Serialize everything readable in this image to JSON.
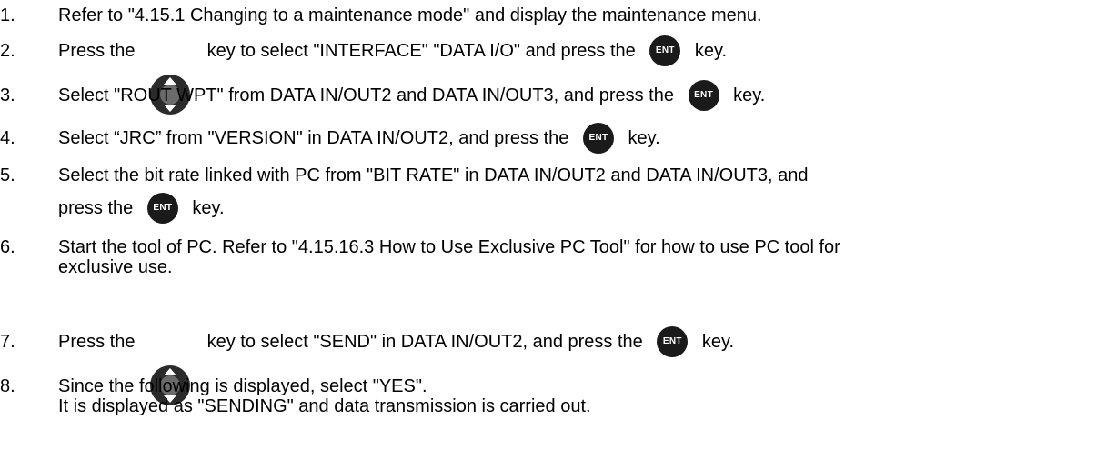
{
  "keys": {
    "ent_label": "ENT",
    "ent_icon": "ent-key-icon",
    "cross_icon": "cursor-key-icon"
  },
  "steps": [
    {
      "num": "1.",
      "text": "Refer to \"4.15.1 Changing to a maintenance mode\" and display the maintenance menu."
    },
    {
      "num": "2.",
      "a": "Press the ",
      "b": " key to select \"INTERFACE\" \"DATA I/O\" and press the ",
      "c": " key."
    },
    {
      "num": "3.",
      "a": "Select \"ROUT WPT\" from DATA IN/OUT2 and DATA IN/OUT3, and press the ",
      "b": " key."
    },
    {
      "num": "4.",
      "a": "Select “JRC” from \"VERSION\" in DATA IN/OUT2, and press the ",
      "b": " key."
    },
    {
      "num": "5.",
      "line1": "Select the bit rate linked with PC from \"BIT RATE\" in DATA IN/OUT2 and DATA IN/OUT3, and",
      "a": "press the ",
      "b": " key."
    },
    {
      "num": "6.",
      "line1": "Start the tool of PC. Refer to \"4.15.16.3 How to Use Exclusive PC Tool\" for how to use PC tool for",
      "line2": "exclusive use."
    },
    {
      "num": "7.",
      "a": "Press the ",
      "b": " key to select \"SEND\" in DATA IN/OUT2, and press the ",
      "c": " key."
    },
    {
      "num": "8.",
      "line1": "Since the following is displayed, select \"YES\".",
      "line2": "It is displayed as \"SENDING\" and data transmission is carried out."
    }
  ]
}
